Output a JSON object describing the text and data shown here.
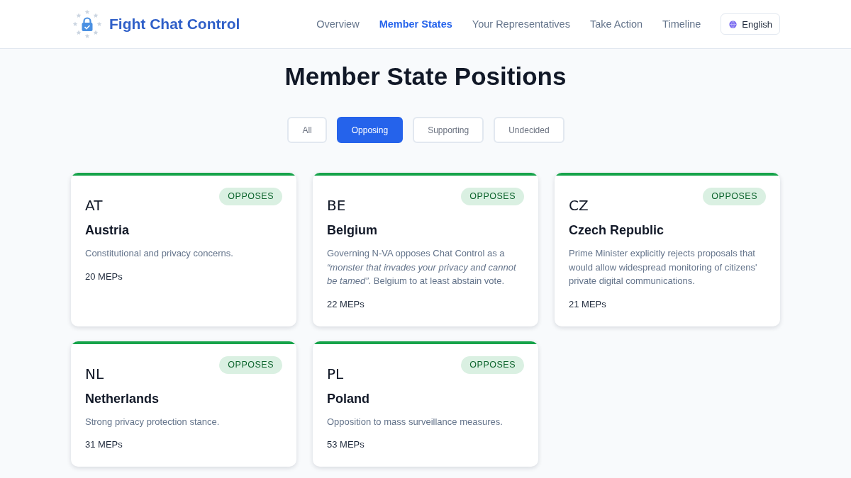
{
  "header": {
    "logo_text": "Fight Chat Control",
    "nav": [
      {
        "label": "Overview",
        "selected": false
      },
      {
        "label": "Member States",
        "selected": true
      },
      {
        "label": "Your Representatives",
        "selected": false
      },
      {
        "label": "Take Action",
        "selected": false
      },
      {
        "label": "Timeline",
        "selected": false
      }
    ],
    "language": "English"
  },
  "page_title": "Member State Positions",
  "filters": [
    {
      "label": "All",
      "selected": false
    },
    {
      "label": "Opposing",
      "selected": true
    },
    {
      "label": "Supporting",
      "selected": false
    },
    {
      "label": "Undecided",
      "selected": false
    }
  ],
  "countries": [
    {
      "code": "AT",
      "name": "Austria",
      "color": "#16a34a",
      "badge": "OPPOSES",
      "description": "Constitutional and privacy concerns.",
      "meps": "20 MEPs"
    },
    {
      "code": "BE",
      "name": "Belgium",
      "color": "#16a34a",
      "badge": "OPPOSES",
      "description": "Governing N-VA opposes Chat Control as a *“monster that invades your privacy and cannot be tamed”*. Belgium to at least abstain vote.",
      "meps": "22 MEPs"
    },
    {
      "code": "CZ",
      "name": "Czech Republic",
      "color": "#16a34a",
      "badge": "OPPOSES",
      "description": "Prime Minister explicitly rejects proposals that would allow widespread monitoring of citizens' private digital communications.",
      "meps": "21 MEPs"
    },
    {
      "code": "NL",
      "name": "Netherlands",
      "color": "#16a34a",
      "badge": "OPPOSES",
      "description": "Strong privacy protection stance.",
      "meps": "31 MEPs"
    },
    {
      "code": "PL",
      "name": "Poland",
      "color": "#16a34a",
      "badge": "OPPOSES",
      "description": "Opposition to mass surveillance measures.",
      "meps": "53 MEPs"
    }
  ]
}
